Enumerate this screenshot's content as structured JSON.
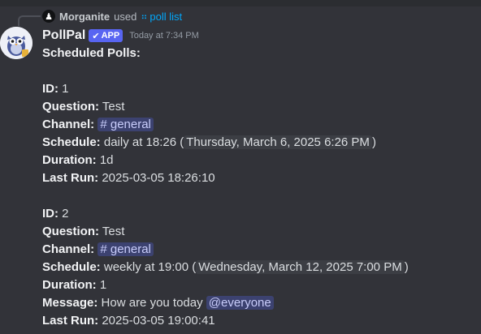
{
  "invocation": {
    "user": "Morganite",
    "used_text": "used",
    "command": "poll list"
  },
  "message": {
    "author": "PollPal",
    "app_badge": "APP",
    "timestamp": "Today at 7:34 PM",
    "heading": "Scheduled Polls:",
    "labels": {
      "id": "ID:",
      "question": "Question:",
      "channel": "Channel:",
      "schedule": "Schedule:",
      "duration": "Duration:",
      "message": "Message:",
      "last_run": "Last Run:"
    },
    "polls": [
      {
        "id": "1",
        "question": "Test",
        "channel": "# general",
        "schedule_text": "daily at 18:26 (",
        "schedule_time": "Thursday, March 6, 2025 6:26 PM",
        "schedule_close": ")",
        "duration": "1d",
        "last_run": "2025-03-05 18:26:10"
      },
      {
        "id": "2",
        "question": "Test",
        "channel": "# general",
        "schedule_text": "weekly at 19:00 (",
        "schedule_time": "Wednesday, March 12, 2025 7:00 PM",
        "schedule_close": ")",
        "duration": "1",
        "message_text": "How are you today",
        "message_mention": "@everyone",
        "last_run": "2025-03-05 19:00:41"
      }
    ]
  },
  "colors": {
    "background": "#323339",
    "accent": "#5865f2",
    "command_link": "#00a8fc",
    "mention_bg": "#3c4270"
  }
}
